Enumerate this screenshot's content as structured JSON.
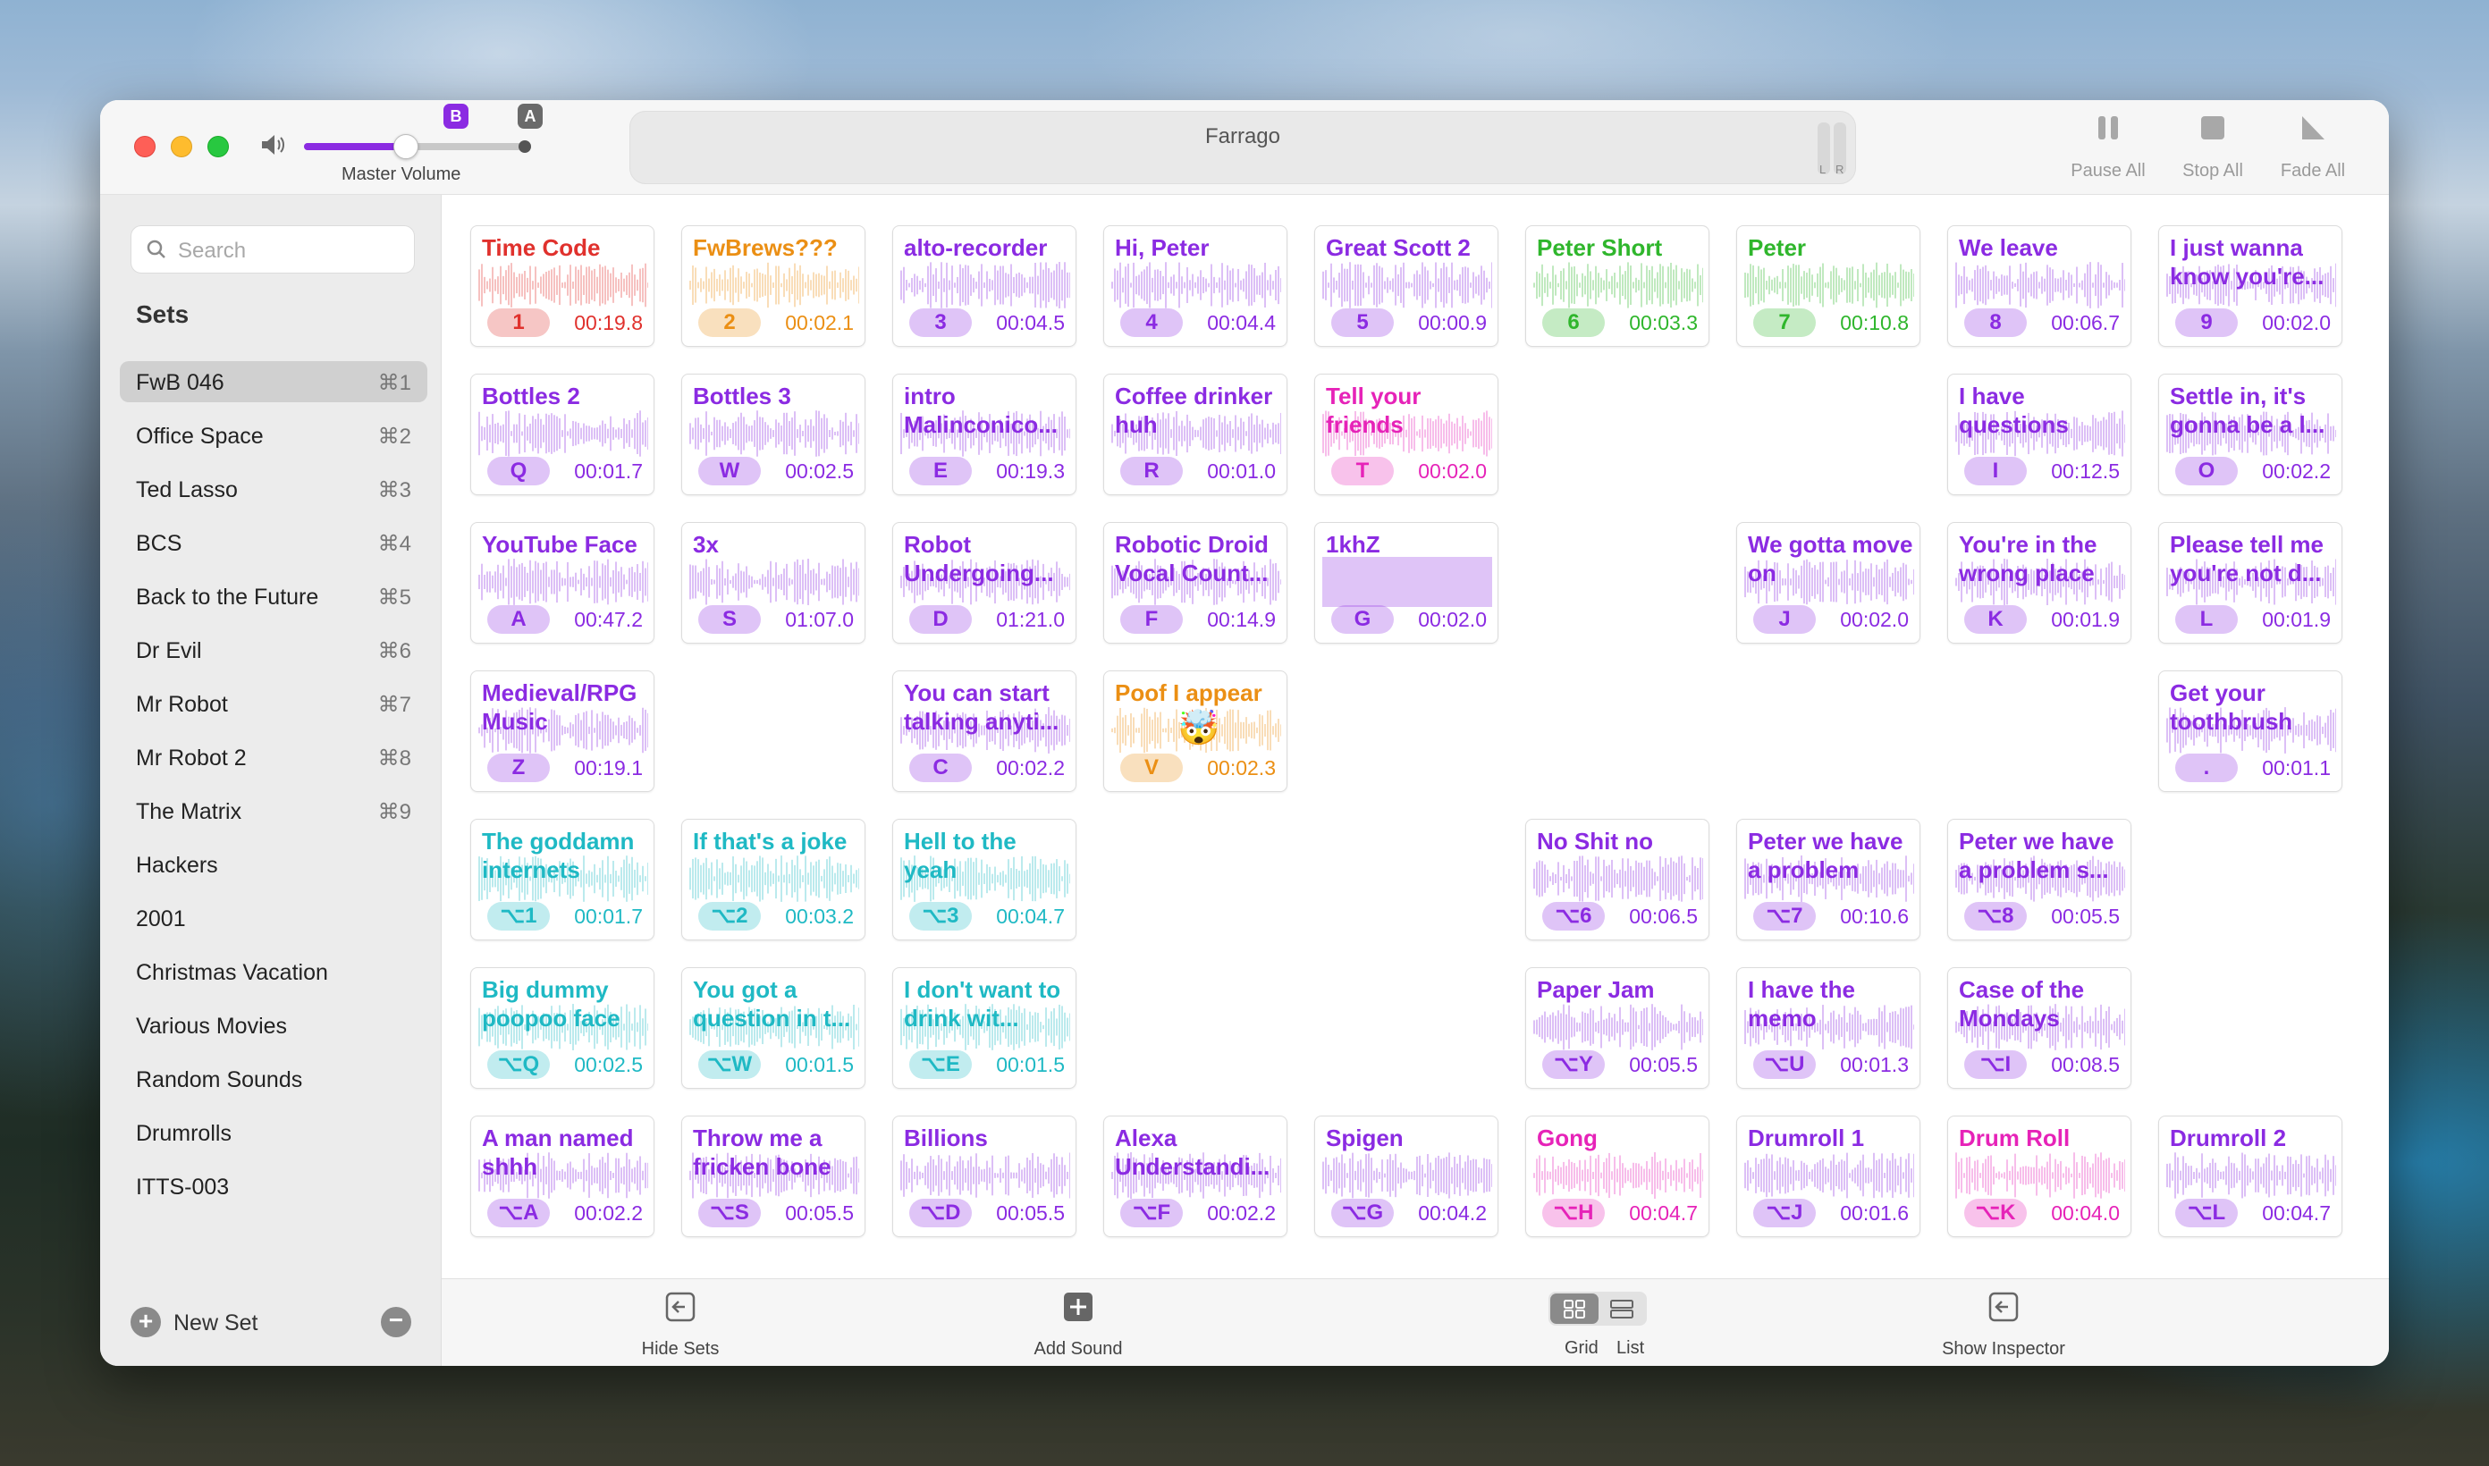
{
  "app": {
    "title": "Farrago"
  },
  "titlebar": {
    "master_volume_label": "Master Volume",
    "master_volume_level": 0.45,
    "marker_b": "B",
    "marker_a": "A",
    "meter_left": "L",
    "meter_right": "R",
    "pause_all": "Pause All",
    "stop_all": "Stop All",
    "fade_all": "Fade All"
  },
  "sidebar": {
    "search_placeholder": "Search",
    "sets_heading": "Sets",
    "items": [
      {
        "label": "FwB 046",
        "shortcut": "⌘1",
        "selected": true
      },
      {
        "label": "Office Space",
        "shortcut": "⌘2"
      },
      {
        "label": "Ted Lasso",
        "shortcut": "⌘3"
      },
      {
        "label": "BCS",
        "shortcut": "⌘4"
      },
      {
        "label": "Back to the Future",
        "shortcut": "⌘5"
      },
      {
        "label": "Dr Evil",
        "shortcut": "⌘6"
      },
      {
        "label": "Mr Robot",
        "shortcut": "⌘7"
      },
      {
        "label": "Mr Robot 2",
        "shortcut": "⌘8"
      },
      {
        "label": "The Matrix",
        "shortcut": "⌘9"
      },
      {
        "label": "Hackers",
        "shortcut": ""
      },
      {
        "label": "2001",
        "shortcut": ""
      },
      {
        "label": "Christmas Vacation",
        "shortcut": ""
      },
      {
        "label": "Various Movies",
        "shortcut": ""
      },
      {
        "label": "Random Sounds",
        "shortcut": ""
      },
      {
        "label": "Drumrolls",
        "shortcut": ""
      },
      {
        "label": "ITTS-003",
        "shortcut": ""
      }
    ],
    "new_set": "New Set"
  },
  "colors": {
    "red": "#e0312d",
    "orange": "#eb8f14",
    "purple": "#8b2be2",
    "green": "#2fb62c",
    "magenta": "#e623b8",
    "teal": "#1fb9c4"
  },
  "tiles": [
    {
      "title": "Time Code",
      "key": "1",
      "duration": "00:19.8",
      "color": "red",
      "col": 0,
      "row": 0
    },
    {
      "title": "FwBrews???",
      "key": "2",
      "duration": "00:02.1",
      "color": "orange",
      "col": 1,
      "row": 0
    },
    {
      "title": "alto-recorder",
      "key": "3",
      "duration": "00:04.5",
      "color": "purple",
      "col": 2,
      "row": 0
    },
    {
      "title": "Hi, Peter",
      "key": "4",
      "duration": "00:04.4",
      "color": "purple",
      "col": 3,
      "row": 0
    },
    {
      "title": "Great Scott 2",
      "key": "5",
      "duration": "00:00.9",
      "color": "purple",
      "col": 4,
      "row": 0
    },
    {
      "title": "Peter Short",
      "key": "6",
      "duration": "00:03.3",
      "color": "green",
      "col": 5,
      "row": 0
    },
    {
      "title": "Peter",
      "key": "7",
      "duration": "00:10.8",
      "color": "green",
      "col": 6,
      "row": 0
    },
    {
      "title": "We leave",
      "key": "8",
      "duration": "00:06.7",
      "color": "purple",
      "col": 7,
      "row": 0
    },
    {
      "title": "I just wanna know you're...",
      "key": "9",
      "duration": "00:02.0",
      "color": "purple",
      "col": 8,
      "row": 0
    },
    {
      "title": "Bottles 2",
      "key": "Q",
      "duration": "00:01.7",
      "color": "purple",
      "col": 0,
      "row": 1
    },
    {
      "title": "Bottles 3",
      "key": "W",
      "duration": "00:02.5",
      "color": "purple",
      "col": 1,
      "row": 1
    },
    {
      "title": "intro Malinconico...",
      "key": "E",
      "duration": "00:19.3",
      "color": "purple",
      "col": 2,
      "row": 1
    },
    {
      "title": "Coffee drinker huh",
      "key": "R",
      "duration": "00:01.0",
      "color": "purple",
      "col": 3,
      "row": 1
    },
    {
      "title": "Tell your friends",
      "key": "T",
      "duration": "00:02.0",
      "color": "magenta",
      "col": 4,
      "row": 1
    },
    {
      "title": "I have questions",
      "key": "I",
      "duration": "00:12.5",
      "color": "purple",
      "col": 7,
      "row": 1
    },
    {
      "title": "Settle in, it's gonna be a l...",
      "key": "O",
      "duration": "00:02.2",
      "color": "purple",
      "col": 8,
      "row": 1
    },
    {
      "title": "YouTube Face",
      "key": "A",
      "duration": "00:47.2",
      "color": "purple",
      "col": 0,
      "row": 2
    },
    {
      "title": "3x",
      "key": "S",
      "duration": "01:07.0",
      "color": "purple",
      "col": 1,
      "row": 2
    },
    {
      "title": "Robot Undergoing...",
      "key": "D",
      "duration": "01:21.0",
      "color": "purple",
      "col": 2,
      "row": 2
    },
    {
      "title": "Robotic Droid Vocal Count...",
      "key": "F",
      "duration": "00:14.9",
      "color": "purple",
      "col": 3,
      "row": 2
    },
    {
      "title": "1khZ",
      "key": "G",
      "duration": "00:02.0",
      "color": "purple",
      "col": 4,
      "row": 2,
      "solid": true
    },
    {
      "title": "We gotta move on",
      "key": "J",
      "duration": "00:02.0",
      "color": "purple",
      "col": 6,
      "row": 2
    },
    {
      "title": "You're in the wrong place",
      "key": "K",
      "duration": "00:01.9",
      "color": "purple",
      "col": 7,
      "row": 2
    },
    {
      "title": "Please tell me you're not d...",
      "key": "L",
      "duration": "00:01.9",
      "color": "purple",
      "col": 8,
      "row": 2
    },
    {
      "title": "Medieval/RPG Music",
      "key": "Z",
      "duration": "00:19.1",
      "color": "purple",
      "col": 0,
      "row": 3
    },
    {
      "title": "You can start talking anyti...",
      "key": "C",
      "duration": "00:02.2",
      "color": "purple",
      "col": 2,
      "row": 3
    },
    {
      "title": "Poof I appear",
      "key": "V",
      "duration": "00:02.3",
      "color": "orange",
      "col": 3,
      "row": 3,
      "emoji": "🤯"
    },
    {
      "title": "Get your toothbrush",
      "key": ".",
      "duration": "00:01.1",
      "color": "purple",
      "col": 8,
      "row": 3
    },
    {
      "title": "The goddamn internets",
      "key": "⌥1",
      "duration": "00:01.7",
      "color": "teal",
      "col": 0,
      "row": 4
    },
    {
      "title": "If that's a joke",
      "key": "⌥2",
      "duration": "00:03.2",
      "color": "teal",
      "col": 1,
      "row": 4
    },
    {
      "title": "Hell to the yeah",
      "key": "⌥3",
      "duration": "00:04.7",
      "color": "teal",
      "col": 2,
      "row": 4
    },
    {
      "title": "No Shit no",
      "key": "⌥6",
      "duration": "00:06.5",
      "color": "purple",
      "col": 5,
      "row": 4
    },
    {
      "title": "Peter we have a problem",
      "key": "⌥7",
      "duration": "00:10.6",
      "color": "purple",
      "col": 6,
      "row": 4
    },
    {
      "title": "Peter we have a problem s...",
      "key": "⌥8",
      "duration": "00:05.5",
      "color": "purple",
      "col": 7,
      "row": 4
    },
    {
      "title": "Big dummy poopoo face",
      "key": "⌥Q",
      "duration": "00:02.5",
      "color": "teal",
      "col": 0,
      "row": 5
    },
    {
      "title": "You got a question in t...",
      "key": "⌥W",
      "duration": "00:01.5",
      "color": "teal",
      "col": 1,
      "row": 5
    },
    {
      "title": "I don't want to drink wit...",
      "key": "⌥E",
      "duration": "00:01.5",
      "color": "teal",
      "col": 2,
      "row": 5
    },
    {
      "title": "Paper Jam",
      "key": "⌥Y",
      "duration": "00:05.5",
      "color": "purple",
      "col": 5,
      "row": 5
    },
    {
      "title": "I have the memo",
      "key": "⌥U",
      "duration": "00:01.3",
      "color": "purple",
      "col": 6,
      "row": 5
    },
    {
      "title": "Case of the Mondays",
      "key": "⌥I",
      "duration": "00:08.5",
      "color": "purple",
      "col": 7,
      "row": 5
    },
    {
      "title": "A man named shhh",
      "key": "⌥A",
      "duration": "00:02.2",
      "color": "purple",
      "col": 0,
      "row": 6
    },
    {
      "title": "Throw me a fricken bone",
      "key": "⌥S",
      "duration": "00:05.5",
      "color": "purple",
      "col": 1,
      "row": 6
    },
    {
      "title": "Billions",
      "key": "⌥D",
      "duration": "00:05.5",
      "color": "purple",
      "col": 2,
      "row": 6
    },
    {
      "title": "Alexa Understandi...",
      "key": "⌥F",
      "duration": "00:02.2",
      "color": "purple",
      "col": 3,
      "row": 6
    },
    {
      "title": "Spigen",
      "key": "⌥G",
      "duration": "00:04.2",
      "color": "purple",
      "col": 4,
      "row": 6
    },
    {
      "title": "Gong",
      "key": "⌥H",
      "duration": "00:04.7",
      "color": "magenta",
      "col": 5,
      "row": 6
    },
    {
      "title": "Drumroll 1",
      "key": "⌥J",
      "duration": "00:01.6",
      "color": "purple",
      "col": 6,
      "row": 6
    },
    {
      "title": "Drum Roll",
      "key": "⌥K",
      "duration": "00:04.0",
      "color": "magenta",
      "col": 7,
      "row": 6
    },
    {
      "title": "Drumroll 2",
      "key": "⌥L",
      "duration": "00:04.7",
      "color": "purple",
      "col": 8,
      "row": 6
    }
  ],
  "bottombar": {
    "hide_sets": "Hide Sets",
    "add_sound": "Add Sound",
    "grid": "Grid",
    "list": "List",
    "show_inspector": "Show Inspector"
  }
}
